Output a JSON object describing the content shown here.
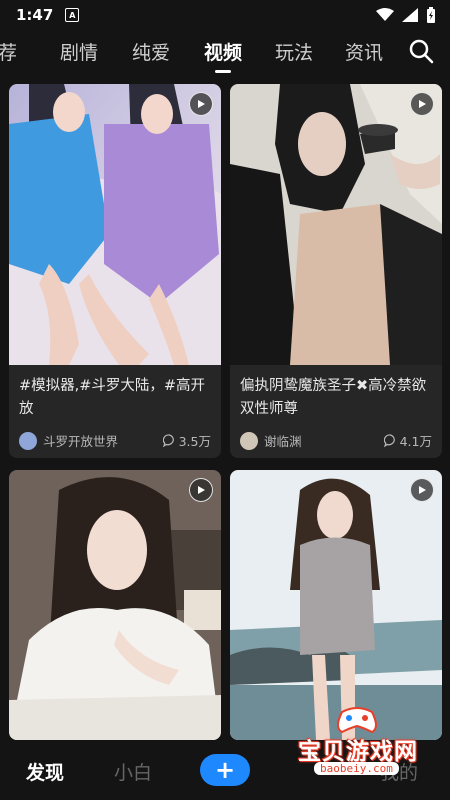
{
  "status": {
    "time": "1:47",
    "notif": "A"
  },
  "tabs": [
    "荐",
    "剧情",
    "纯爱",
    "视频",
    "玩法",
    "资讯"
  ],
  "active_tab": "视频",
  "cards": [
    {
      "title": "#模拟器,#斗罗大陆，#高开放",
      "author": "斗罗开放世界",
      "views": "3.5万"
    },
    {
      "title": "偏执阴鸷魔族圣子✖高冷禁欲双性师尊",
      "author": "谢临渊",
      "views": "4.1万"
    },
    {
      "title": "",
      "author": "",
      "views": ""
    },
    {
      "title": "",
      "author": "",
      "views": ""
    }
  ],
  "nav": {
    "discover": "发现",
    "novice": "小白",
    "add": "+",
    "mine": "我的"
  },
  "watermark": {
    "main": "宝贝游戏网",
    "sub": "baobeiy.com"
  },
  "colors": {
    "accent": "#1e88ff",
    "background": "#141414",
    "card": "#262626"
  }
}
